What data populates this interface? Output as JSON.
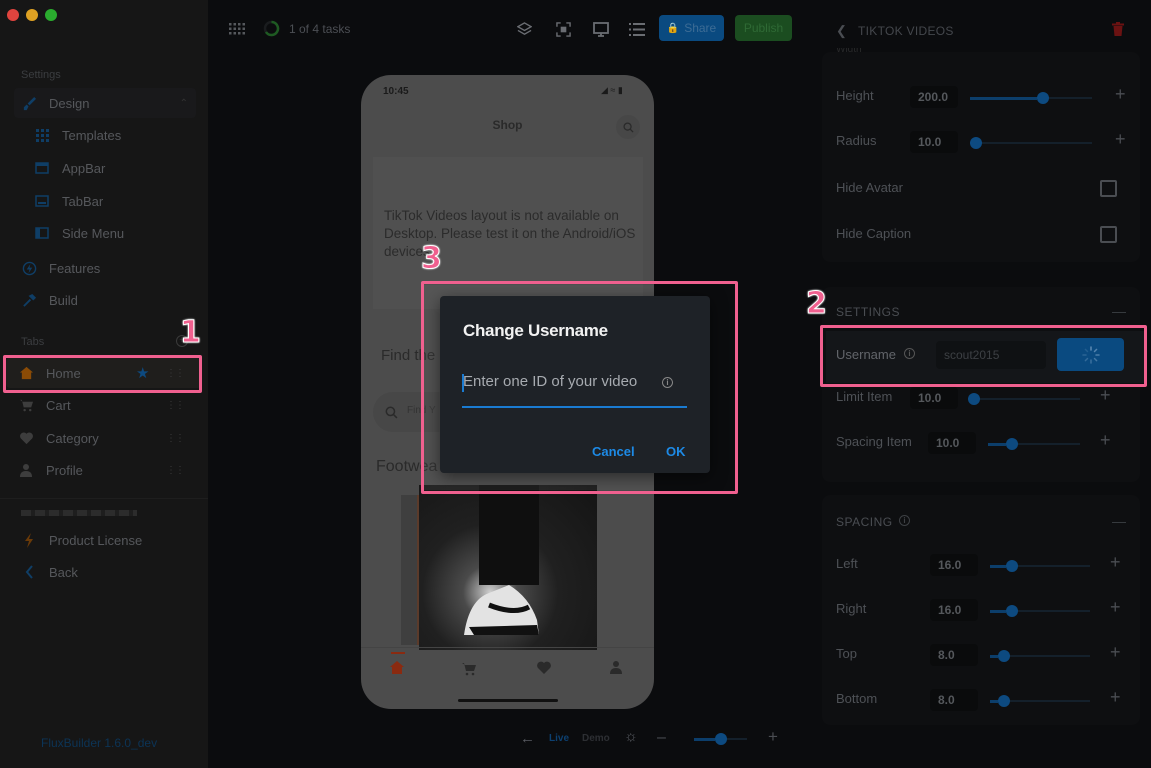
{
  "window": {
    "traffic_lights": [
      "#e0443e",
      "#dea123",
      "#2aac2e"
    ]
  },
  "sidebar": {
    "settings_label": "Settings",
    "design": {
      "label": "Design",
      "icon": "paintbrush-icon"
    },
    "design_children": [
      {
        "label": "Templates",
        "icon": "grid-icon"
      },
      {
        "label": "AppBar",
        "icon": "appbar-icon"
      },
      {
        "label": "TabBar",
        "icon": "tabbar-icon"
      },
      {
        "label": "Side Menu",
        "icon": "sidemenu-icon"
      }
    ],
    "features": {
      "label": "Features",
      "icon": "bolt-circle-icon"
    },
    "build": {
      "label": "Build",
      "icon": "hammer-icon"
    },
    "tabs_label": "Tabs",
    "tabs": [
      {
        "label": "Home",
        "icon": "home-icon",
        "starred": true
      },
      {
        "label": "Cart",
        "icon": "cart-icon"
      },
      {
        "label": "Category",
        "icon": "heart-icon"
      },
      {
        "label": "Profile",
        "icon": "person-icon"
      }
    ],
    "product_license": "Product License",
    "back": "Back",
    "version": "FluxBuilder 1.6.0_dev"
  },
  "topbar": {
    "tasks_text": "1 of 4 tasks",
    "share_label": "Share",
    "publish_label": "Publish",
    "share_color": "#0a4a80",
    "publish_color": "#1b4d20"
  },
  "phone": {
    "time": "10:45",
    "title": "Shop",
    "notice": "TikTok Videos layout is not available on Desktop. Please test it on the Android/iOS devices.",
    "find_text": "Find the",
    "search_placeholder": "Find Y",
    "section_title": "Footwea",
    "nav": [
      "home-icon",
      "cart-icon",
      "heart-icon",
      "person-icon"
    ]
  },
  "dialog": {
    "title": "Change Username",
    "input_placeholder": "Enter one ID of your video",
    "cancel_label": "Cancel",
    "ok_label": "OK"
  },
  "preview_controls": {
    "live_label": "Live",
    "demo_label": "Demo",
    "zoom_fraction": 0.4
  },
  "panel": {
    "title": "TIKTOK VIDEOS",
    "size_rows": [
      {
        "label": "Height",
        "value": "200.0",
        "fraction": 0.55
      },
      {
        "label": "Radius",
        "value": "10.0",
        "fraction": 0.0
      }
    ],
    "checkboxes": [
      {
        "label": "Hide Avatar",
        "checked": false
      },
      {
        "label": "Hide Caption",
        "checked": false
      }
    ],
    "settings_title": "SETTINGS",
    "username_label": "Username",
    "username_value": "scout2015",
    "settings_rows": [
      {
        "label": "Limit Item",
        "value": "10.0",
        "fraction": 0.0
      },
      {
        "label": "Spacing Item",
        "value": "10.0",
        "fraction": 0.2
      }
    ],
    "spacing_title": "SPACING",
    "spacing_rows": [
      {
        "label": "Left",
        "value": "16.0",
        "fraction": 0.16
      },
      {
        "label": "Right",
        "value": "16.0",
        "fraction": 0.16
      },
      {
        "label": "Top",
        "value": "8.0",
        "fraction": 0.08
      },
      {
        "label": "Bottom",
        "value": "8.0",
        "fraction": 0.08
      }
    ]
  },
  "annotations": [
    "1",
    "2",
    "3"
  ],
  "highlight_color": "#f0608f"
}
